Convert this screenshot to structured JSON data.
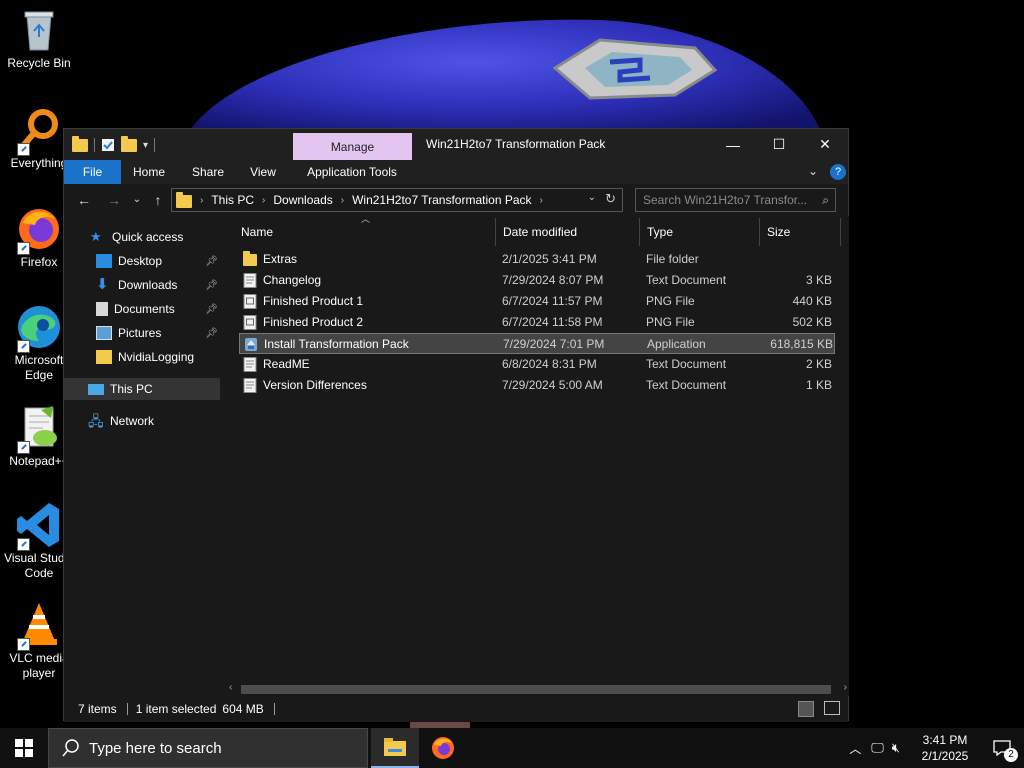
{
  "desktop": {
    "icons": [
      {
        "label": "Recycle Bin",
        "icon": "recycle-bin-icon"
      },
      {
        "label": "Everything",
        "icon": "everything-search-icon"
      },
      {
        "label": "Firefox",
        "icon": "firefox-icon"
      },
      {
        "label": "Microsoft Edge",
        "icon": "edge-icon"
      },
      {
        "label": "Notepad++",
        "icon": "notepad-plus-plus-icon"
      },
      {
        "label": "Visual Studio Code",
        "icon": "vscode-icon"
      },
      {
        "label": "VLC media player",
        "icon": "vlc-icon"
      }
    ]
  },
  "window": {
    "title": "Win21H2to7 Transformation Pack",
    "manage_tab": "Manage",
    "ribbon_tabs": [
      "File",
      "Home",
      "Share",
      "View",
      "Application Tools"
    ],
    "controls": {
      "minimize": "—",
      "maximize": "☐",
      "close": "✕"
    },
    "address": {
      "crumbs": [
        "This PC",
        "Downloads",
        "Win21H2to7 Transformation Pack"
      ]
    },
    "search_placeholder": "Search Win21H2to7 Transfor...",
    "nav": {
      "quick_access": "Quick access",
      "pinned": [
        "Desktop",
        "Downloads",
        "Documents",
        "Pictures"
      ],
      "other": "NvidiaLogging",
      "this_pc": "This PC",
      "network": "Network"
    },
    "columns": {
      "name": "Name",
      "date": "Date modified",
      "type": "Type",
      "size": "Size"
    },
    "files": [
      {
        "name": "Extras",
        "date": "2/1/2025 3:41 PM",
        "type": "File folder",
        "size": "",
        "kind": "folder"
      },
      {
        "name": "Changelog",
        "date": "7/29/2024 8:07 PM",
        "type": "Text Document",
        "size": "3 KB",
        "kind": "text"
      },
      {
        "name": "Finished Product 1",
        "date": "6/7/2024 11:57 PM",
        "type": "PNG File",
        "size": "440 KB",
        "kind": "image"
      },
      {
        "name": "Finished Product 2",
        "date": "6/7/2024 11:58 PM",
        "type": "PNG File",
        "size": "502 KB",
        "kind": "image"
      },
      {
        "name": "Install Transformation Pack",
        "date": "7/29/2024 7:01 PM",
        "type": "Application",
        "size": "618,815 KB",
        "kind": "app",
        "selected": true
      },
      {
        "name": "ReadME",
        "date": "6/8/2024 8:31 PM",
        "type": "Text Document",
        "size": "2 KB",
        "kind": "text"
      },
      {
        "name": "Version Differences",
        "date": "7/29/2024 5:00 AM",
        "type": "Text Document",
        "size": "1 KB",
        "kind": "text"
      }
    ],
    "status": {
      "items": "7 items",
      "selected": "1 item selected",
      "size": "604 MB"
    }
  },
  "taskbar": {
    "search_placeholder": "Type here to search",
    "time": "3:41 PM",
    "date": "2/1/2025",
    "notifications": "2"
  },
  "colors": {
    "accent": "#1a73c9",
    "manage_tab": "#e2c6f0",
    "folder": "#f3c94e",
    "wallpaper_cap": "#2d2fb8"
  }
}
